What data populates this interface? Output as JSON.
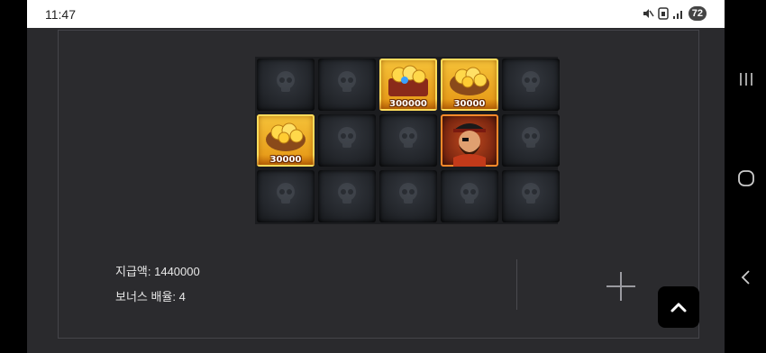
{
  "status_bar": {
    "time": "11:47",
    "battery": "72"
  },
  "grid": {
    "rows": [
      [
        {
          "kind": "empty",
          "label": ""
        },
        {
          "kind": "empty",
          "label": ""
        },
        {
          "kind": "treasure",
          "label": "300000"
        },
        {
          "kind": "coin-sack",
          "label": "30000"
        },
        {
          "kind": "empty",
          "label": ""
        }
      ],
      [
        {
          "kind": "coin-sack",
          "label": "30000"
        },
        {
          "kind": "empty",
          "label": ""
        },
        {
          "kind": "empty",
          "label": ""
        },
        {
          "kind": "pirate",
          "label": ""
        },
        {
          "kind": "empty",
          "label": ""
        }
      ],
      [
        {
          "kind": "empty",
          "label": ""
        },
        {
          "kind": "empty",
          "label": ""
        },
        {
          "kind": "empty",
          "label": ""
        },
        {
          "kind": "empty",
          "label": ""
        },
        {
          "kind": "empty",
          "label": ""
        }
      ]
    ]
  },
  "info": {
    "payout": "지급액: 1440000",
    "bonus_multiplier": "보너스 배율: 4"
  },
  "icons": {
    "add": "plus-icon",
    "scroll_top": "chevron-up-icon",
    "nav": [
      "recent-apps-icon",
      "home-icon",
      "back-icon"
    ]
  },
  "colors": {
    "gold": "#f0b52a",
    "pirate": "#c24a1f",
    "background": "#2a2a2d"
  }
}
